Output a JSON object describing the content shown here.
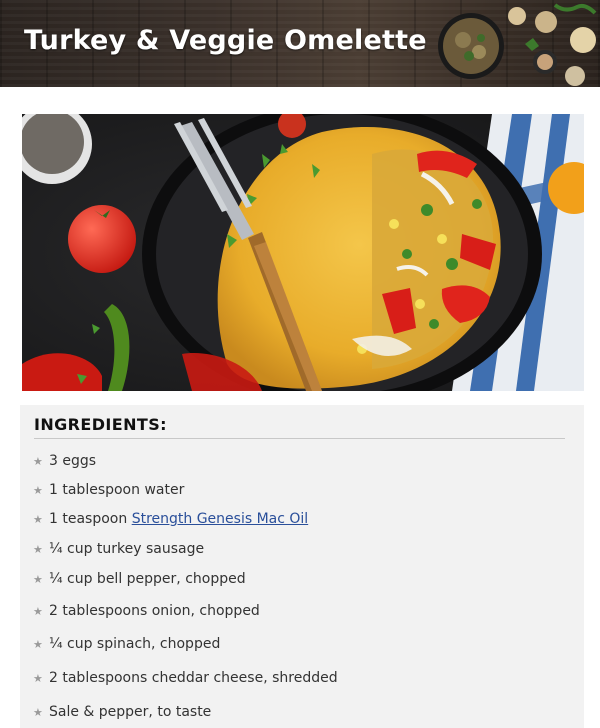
{
  "header": {
    "title": "Turkey & Veggie Omelette"
  },
  "hero": {
    "image": "omelette-on-black-plate-with-fork-photo"
  },
  "ingredients": {
    "heading": "INGREDIENTS:",
    "bullet_icon": "star-icon",
    "items": [
      {
        "text": "3 eggs"
      },
      {
        "text": "1 tablespoon water"
      },
      {
        "prefix": "1 teaspoon ",
        "link": "Strength Genesis Mac Oil"
      },
      {
        "text": "¼ cup turkey sausage"
      },
      {
        "text": "¼ cup bell pepper, chopped"
      },
      {
        "text": "2 tablespoons onion, chopped"
      },
      {
        "text": "¼ cup spinach, chopped"
      },
      {
        "text": "2 tablespoons cheddar cheese, shredded"
      },
      {
        "text": "Sale & pepper, to taste"
      }
    ]
  },
  "colors": {
    "link": "#2a4f9a",
    "card_background": "#f2f2f2",
    "banner": "#3a302a"
  }
}
